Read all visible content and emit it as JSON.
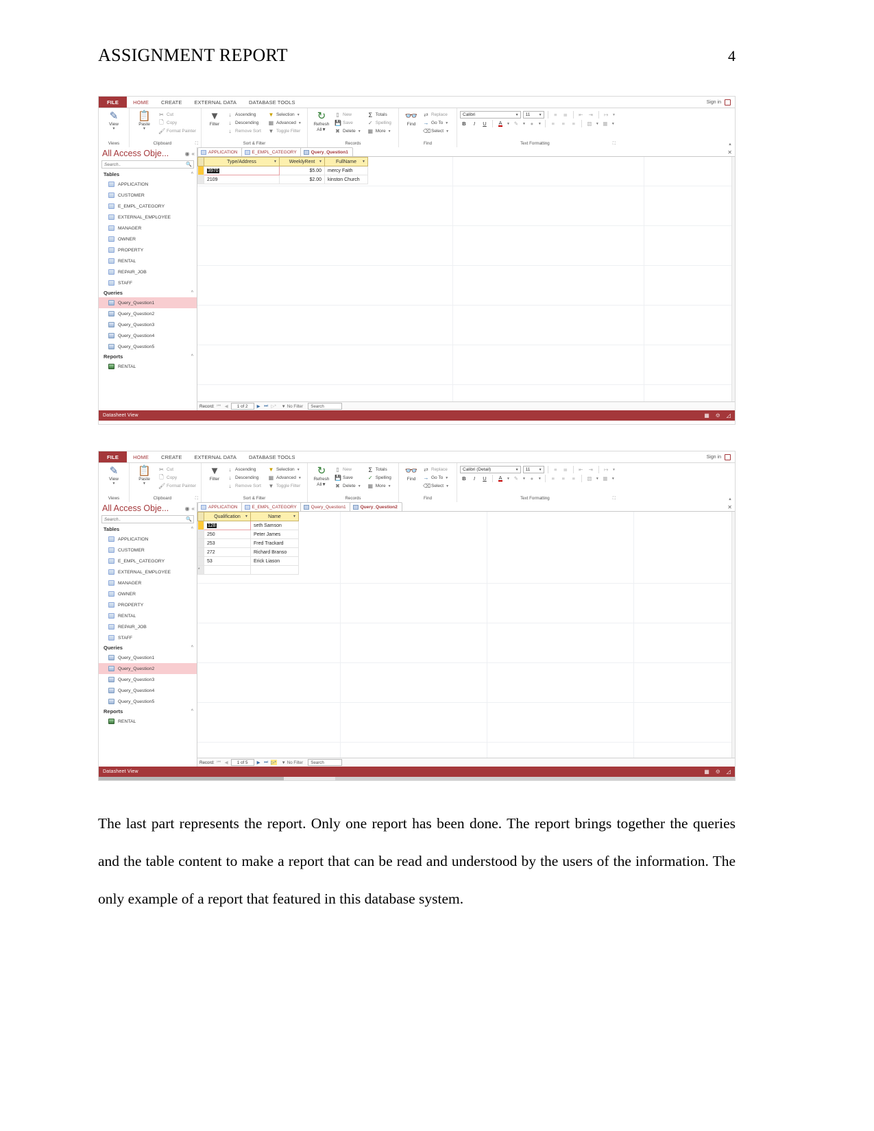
{
  "document": {
    "title": "ASSIGNMENT REPORT",
    "page_number": "4",
    "paragraph": "The last part represents the report. Only one report has been done. The report brings together the queries and the table content to make a report that can be read and understood by the users of the information. The only example of a report that featured in this database system."
  },
  "ribbon": {
    "file_tab": "FILE",
    "tabs": [
      "HOME",
      "CREATE",
      "EXTERNAL DATA",
      "DATABASE TOOLS"
    ],
    "active_tab": "HOME",
    "sign_in": "Sign in",
    "groups": {
      "views": {
        "label": "Views",
        "view_button": "View"
      },
      "clipboard": {
        "label": "Clipboard",
        "paste": "Paste",
        "cut": "Cut",
        "copy": "Copy",
        "format_painter": "Format Painter"
      },
      "sort_filter": {
        "label": "Sort & Filter",
        "filter": "Filter",
        "ascending": "Ascending",
        "descending": "Descending",
        "remove_sort": "Remove Sort",
        "selection": "Selection",
        "advanced": "Advanced",
        "toggle_filter": "Toggle Filter"
      },
      "records": {
        "label": "Records",
        "refresh_all": "Refresh All",
        "new": "New",
        "save": "Save",
        "delete": "Delete",
        "totals": "Totals",
        "spelling": "Spelling",
        "more": "More"
      },
      "find": {
        "label": "Find",
        "find": "Find",
        "replace": "Replace",
        "go_to": "Go To",
        "select": "Select"
      },
      "text_formatting": {
        "label": "Text Formatting",
        "bold": "B",
        "italic": "I",
        "underline": "U"
      }
    }
  },
  "nav_pane": {
    "title": "All Access Obje...",
    "search_placeholder": "Search..",
    "sections": [
      {
        "label": "Tables",
        "items": [
          "APPLICATION",
          "CUSTOMER",
          "E_EMPL_CATEGORY",
          "EXTERNAL_EMPLOYEE",
          "MANAGER",
          "OWNER",
          "PROPERTY",
          "RENTAL",
          "REPAIR_JOB",
          "STAFF"
        ]
      },
      {
        "label": "Queries",
        "items": [
          "Query_Question1",
          "Query_Question2",
          "Query_Question3",
          "Query_Question4",
          "Query_Question5"
        ]
      },
      {
        "label": "Reports",
        "items": [
          "RENTAL"
        ]
      }
    ]
  },
  "screenshot1": {
    "font_name": "Calibri",
    "font_size": "11",
    "doc_tabs": [
      {
        "label": "APPLICATION",
        "type": "table",
        "active": false
      },
      {
        "label": "E_EMPL_CATEGORY",
        "type": "table",
        "active": false
      },
      {
        "label": "Query_Question1",
        "type": "query",
        "active": true
      }
    ],
    "selected_nav_item": "Query_Question1",
    "datasheet": {
      "columns": [
        "Type/Address",
        "WeeklyRent",
        "FullName"
      ],
      "rows": [
        {
          "type_address": "3970",
          "weekly_rent": "$5.00",
          "full_name": "mercy Faith"
        },
        {
          "type_address": "2109",
          "weekly_rent": "$2.00",
          "full_name": "kinston Church"
        }
      ]
    },
    "record_nav": {
      "label": "Record:",
      "position": "1 of 2",
      "filter_status": "No Filter",
      "search_placeholder": "Search"
    },
    "status_bar": "Datasheet View"
  },
  "screenshot2": {
    "font_name": "Calibri (Detail)",
    "font_size": "11",
    "doc_tabs": [
      {
        "label": "APPLICATION",
        "type": "table",
        "active": false
      },
      {
        "label": "E_EMPL_CATEGORY",
        "type": "table",
        "active": false
      },
      {
        "label": "Query_Question1",
        "type": "query",
        "active": false
      },
      {
        "label": "Query_Question2",
        "type": "query",
        "active": true
      }
    ],
    "selected_nav_item": "Query_Question2",
    "datasheet": {
      "columns": [
        "Qualification",
        "Name"
      ],
      "rows": [
        {
          "qualification": "128",
          "name": "seth Samson"
        },
        {
          "qualification": "250",
          "name": "Peter James"
        },
        {
          "qualification": "253",
          "name": "Fred Trackard"
        },
        {
          "qualification": "272",
          "name": "Richard Branso"
        },
        {
          "qualification": "53",
          "name": "Erick Liason"
        }
      ]
    },
    "record_nav": {
      "label": "Record:",
      "position": "1 of 5",
      "filter_status": "No Filter",
      "search_placeholder": "Search"
    },
    "status_bar": "Datasheet View"
  },
  "colors": {
    "accent": "#a4373a",
    "header_yellow": "#fdf0ae",
    "selection_blue": "#4a90d9",
    "selected_nav": "#f8cdd0"
  }
}
